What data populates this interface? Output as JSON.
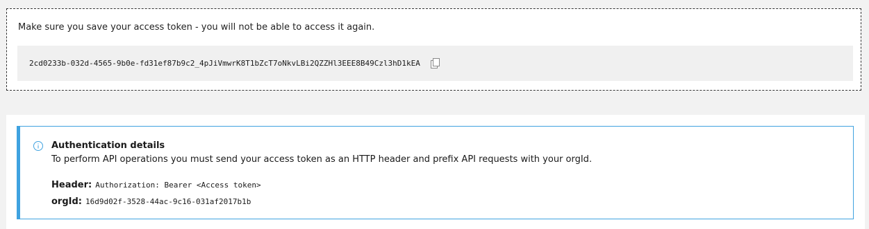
{
  "token_section": {
    "message": "Make sure you save your access token - you will not be able to access it again.",
    "token": "2cd0233b-032d-4565-9b0e-fd31ef87b9c2_4pJiVmwrK8T1bZcT7oNkvLBi2QZZHl3EEE8B49Czl3hD1kEA",
    "copy_icon": "copy-icon"
  },
  "auth_details": {
    "info_icon": "info-icon",
    "title": "Authentication details",
    "description": "To perform API operations you must send your access token as an HTTP header and prefix API requests with your orgId.",
    "header_label": "Header:",
    "header_value": "Authorization: Bearer <Access token>",
    "orgid_label": "orgId:",
    "orgid_value": "16d9d02f-3528-44ac-9c16-031af2017b1b"
  },
  "colors": {
    "info_accent": "#3fa2e0",
    "token_bg": "#f0f0f0",
    "page_bg": "#f2f2f2"
  }
}
